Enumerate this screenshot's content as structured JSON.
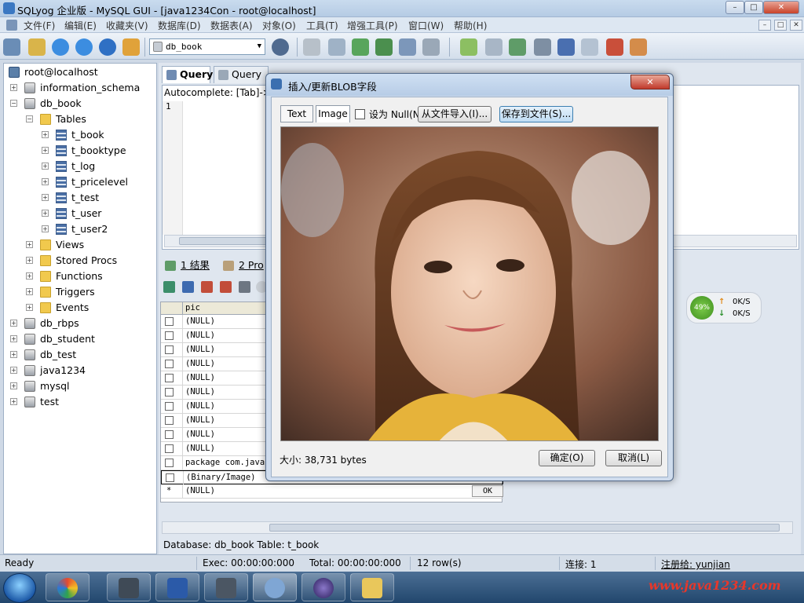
{
  "window": {
    "title": "SQLyog 企业版 - MySQL GUI - [java1234Con - root@localhost]",
    "controls": {
      "minimize": "–",
      "maximize": "□",
      "close": "✕"
    }
  },
  "menu": [
    "文件(F)",
    "编辑(E)",
    "收藏夹(V)",
    "数据库(D)",
    "数据表(A)",
    "对象(O)",
    "工具(T)",
    "增强工具(P)",
    "窗口(W)",
    "帮助(H)"
  ],
  "toolbar": {
    "database_select": "db_book"
  },
  "object_browser": {
    "root": "root@localhost",
    "databases": {
      "information_schema": "information_schema",
      "db_book": "db_book",
      "tables_folder": "Tables",
      "tables": [
        "t_book",
        "t_booktype",
        "t_log",
        "t_pricelevel",
        "t_test",
        "t_user",
        "t_user2"
      ],
      "views": "Views",
      "procs": "Stored Procs",
      "functions": "Functions",
      "triggers": "Triggers",
      "events": "Events",
      "others": [
        "db_rbps",
        "db_student",
        "db_test",
        "java1234",
        "mysql",
        "test"
      ]
    }
  },
  "query_tabs": {
    "query": "Query",
    "builder": "Query B"
  },
  "editor": {
    "autocomplete": "Autocomplete: [Tab]->",
    "line": "1"
  },
  "result_tabs": {
    "results": "1 结果",
    "profiler": "2 Pro"
  },
  "grid": {
    "column": "pic",
    "rows": [
      "(NULL)",
      "(NULL)",
      "(NULL)",
      "(NULL)",
      "(NULL)",
      "(NULL)",
      "(NULL)",
      "(NULL)",
      "(NULL)",
      "(NULL)",
      "package com.java12",
      "(Binary/Image)",
      "(NULL)"
    ],
    "new_row_marker": "*",
    "ok_button": "OK"
  },
  "net_widget": {
    "cpu": "49%",
    "up": "0K/S",
    "down": "0K/S"
  },
  "infobar": "Database: db_book  Table: t_book",
  "status": {
    "ready": "Ready",
    "exec": "Exec: 00:00:00:000",
    "total": "Total: 00:00:00:000",
    "rows": "12 row(s)",
    "conn": "连接: 1",
    "reg": "注册给: yunjian"
  },
  "watermark": "www.java1234.com",
  "dialog": {
    "title": "插入/更新BLOB字段",
    "tab_text": "Text",
    "tab_image": "Image",
    "set_null": "设为 Null(N",
    "import_btn": "从文件导入(I)...",
    "save_btn": "保存到文件(S)...",
    "size": "大小: 38,731 bytes",
    "ok": "确定(O)",
    "cancel": "取消(L)"
  },
  "colors": {
    "accent": "#3b78c2",
    "close_red": "#c9432a",
    "watermark": "#e8372a"
  }
}
